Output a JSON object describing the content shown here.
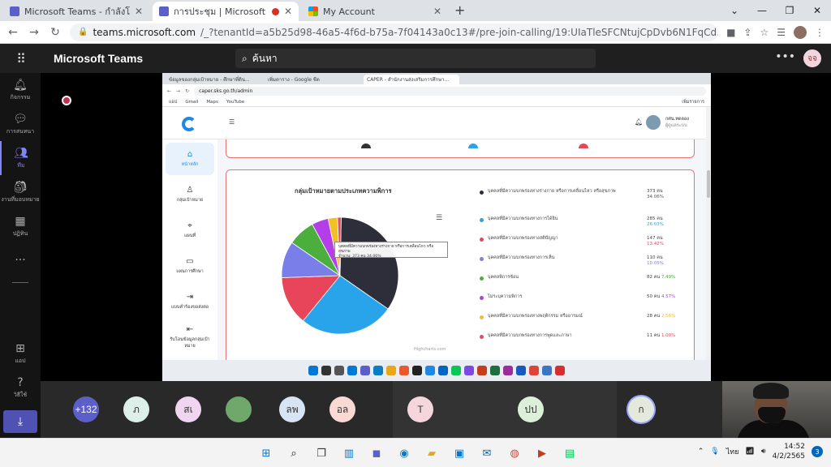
{
  "browser": {
    "tabs": [
      {
        "title": "Microsoft Teams - กำลังโหลด",
        "icon": "teams"
      },
      {
        "title": "การประชุม | Microsoft Teams",
        "icon": "teams"
      },
      {
        "title": "My Account",
        "icon": "ms"
      }
    ],
    "url_host": "teams.microsoft.com",
    "url_path": "/_?tenantId=a5b25d98-46a5-4f6d-b75a-7f04143a0c13#/pre-join-calling/19:UIaTleSFCNtujCpDvb6N1FqCd3d-KReVjn6lEyPpxEI1@thread.tacv2"
  },
  "teams": {
    "app_title": "Microsoft Teams",
    "search_placeholder": "ค้นหา",
    "me_initials": "จจ",
    "rail": [
      {
        "label": "กิจกรรม",
        "icon": "bell-icon"
      },
      {
        "label": "การสนทนา",
        "icon": "chat-icon"
      },
      {
        "label": "ทีม",
        "icon": "teams-icon"
      },
      {
        "label": "งานที่มอบหมาย",
        "icon": "assignments-icon"
      },
      {
        "label": "ปฏิทิน",
        "icon": "calendar-icon"
      },
      {
        "label": "แอป",
        "icon": "apps-icon"
      },
      {
        "label": "วิธีใช้",
        "icon": "help-icon"
      }
    ]
  },
  "shared": {
    "tabs": [
      "ข้อมูลของกลุ่มเป้าหมาย - ศึกษาที่ดิน...",
      "เพิ่มตาราง - Google ชีต",
      "CAPER - สำนักงานส่งเสริมการศึกษา..."
    ],
    "url": "caper.sks.go.th/admin",
    "bookmarks": [
      "แอป",
      "Gmail",
      "Maps",
      "YouTube"
    ],
    "bookmark_right": "เพิ่มรายการ",
    "user_name": "กศน.ทดลอง",
    "user_role": "ผู้ดูแลระบบ",
    "side": [
      {
        "label": "หน้าหลัก",
        "icon": "home-icon"
      },
      {
        "label": "กลุ่มเป้าหมาย",
        "icon": "user-icon"
      },
      {
        "label": "แผนที่",
        "icon": "map-pin-icon"
      },
      {
        "label": "แผนการศึกษา",
        "icon": "folder-icon"
      },
      {
        "label": "แบบคำร้องขอส่งต่อ",
        "icon": "export-icon"
      },
      {
        "label": "รับโอนข้อมูลกลุ่มเป้าหมาย",
        "icon": "import-icon"
      }
    ],
    "credits": "Highcharts.com",
    "tooltip_line1": "บุคคลที่มีความบกพร่องทางร่างกาย หรือการเคลื่อนไหว หรือสุขภาพ",
    "tooltip_line2": "จำนวน: 373 คน 34.06%"
  },
  "chart_data": {
    "type": "pie",
    "title": "กลุ่มเป้าหมายตามประเภทความพิการ",
    "series": [
      {
        "name": "บุคคลที่มีความบกพร่องทางร่างกาย หรือการเคลื่อนไหว หรือสุขภาพ",
        "value": 373,
        "value_label": "373 คน",
        "percent": 34.06,
        "percent_label": "34.06%",
        "color": "#2e2e3a"
      },
      {
        "name": "บุคคลที่มีความบกพร่องทางการได้ยิน",
        "value": 285,
        "value_label": "285 คน",
        "percent": 26.03,
        "percent_label": "26.03%",
        "color": "#29a3ea"
      },
      {
        "name": "บุคคลที่มีความบกพร่องทางสติปัญญา",
        "value": 147,
        "value_label": "147 คน",
        "percent": 13.42,
        "percent_label": "13.42%",
        "color": "#e8455a"
      },
      {
        "name": "บุคคลที่มีความบกพร่องทางการเห็น",
        "value": 110,
        "value_label": "110 คน",
        "percent": 10.05,
        "percent_label": "10.05%",
        "color": "#7a7ee8"
      },
      {
        "name": "บุคคลพิการซ้อน",
        "value": 82,
        "value_label": "82 คน",
        "percent": 7.49,
        "percent_label": "7.49%",
        "color": "#4cae3c"
      },
      {
        "name": "ไม่ระบุความพิการ",
        "value": 50,
        "value_label": "50 คน",
        "percent": 4.57,
        "percent_label": "4.57%",
        "color": "#b43ee8"
      },
      {
        "name": "บุคคลที่มีความบกพร่องทางพฤติกรรม หรืออารมณ์",
        "value": 28,
        "value_label": "28 คน",
        "percent": 2.56,
        "percent_label": "2.56%",
        "color": "#f2c023"
      },
      {
        "name": "บุคคลที่มีความบกพร่องทางการพูดและภาษา",
        "value": 11,
        "value_label": "11 คน",
        "percent": 1.0,
        "percent_label": "1.00%",
        "color": "#e84a5f"
      }
    ]
  },
  "participants": [
    {
      "label": "+132",
      "bg": "#5b5fc7",
      "fg": "#ffffff"
    },
    {
      "label": "ภ",
      "bg": "#dcefe9",
      "fg": "#333333"
    },
    {
      "label": "สเ",
      "bg": "#f0d5f0",
      "fg": "#333333"
    },
    {
      "label": "",
      "bg": "#6fa86a",
      "fg": "#333333"
    },
    {
      "label": "ลพ",
      "bg": "#d7e4f4",
      "fg": "#333333"
    },
    {
      "label": "อล",
      "bg": "#f9d9d3",
      "fg": "#333333"
    },
    {
      "label": "T",
      "bg": "#f5d6dc",
      "fg": "#333333"
    },
    {
      "label": "ปป",
      "bg": "#dcefd9",
      "fg": "#333333"
    },
    {
      "label": "ก",
      "bg": "#e3eadb",
      "fg": "#333333"
    }
  ],
  "taskbar": {
    "lang": "ไทย",
    "time": "14:52",
    "date": "4/2/2565",
    "notifications": "3"
  }
}
